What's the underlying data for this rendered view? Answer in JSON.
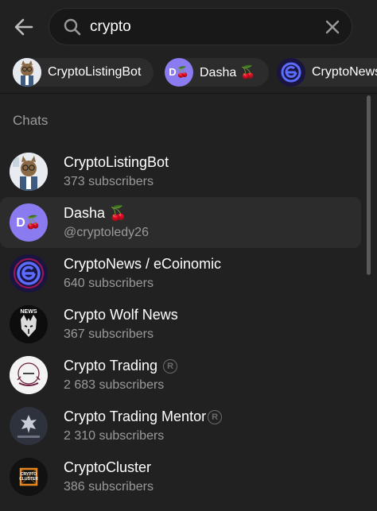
{
  "search": {
    "value": "crypto",
    "placeholder": "Search"
  },
  "chips": [
    {
      "label": "CryptoListingBot"
    },
    {
      "label": "Dasha 🍒",
      "avatar_text": "D🍒"
    },
    {
      "label": "CryptoNews / eCoinomic"
    }
  ],
  "section_title": "Chats",
  "chats": [
    {
      "name": "CryptoListingBot",
      "sub": "373 subscribers"
    },
    {
      "name": "Dasha 🍒",
      "sub": "@cryptoledy26",
      "avatar_text": "D🍒"
    },
    {
      "name": "CryptoNews / eCoinomic",
      "sub": "640 subscribers"
    },
    {
      "name": "Crypto Wolf News",
      "sub": "367 subscribers",
      "avatar_text": "NEWS"
    },
    {
      "name": "Crypto Trading",
      "sub": "2 683 subscribers",
      "verified_mark": "R"
    },
    {
      "name": "Crypto Trading Mentor",
      "sub": "2 310 subscribers",
      "verified_mark": "R"
    },
    {
      "name": "CryptoCluster",
      "sub": "386 subscribers",
      "avatar_text": "CRYPTO CLUSTER"
    }
  ],
  "colors": {
    "background": "#212121",
    "selected_row": "#2c2c2c",
    "secondary_text": "#9a9a9a",
    "dasha_avatar": "#8a7cf0"
  }
}
